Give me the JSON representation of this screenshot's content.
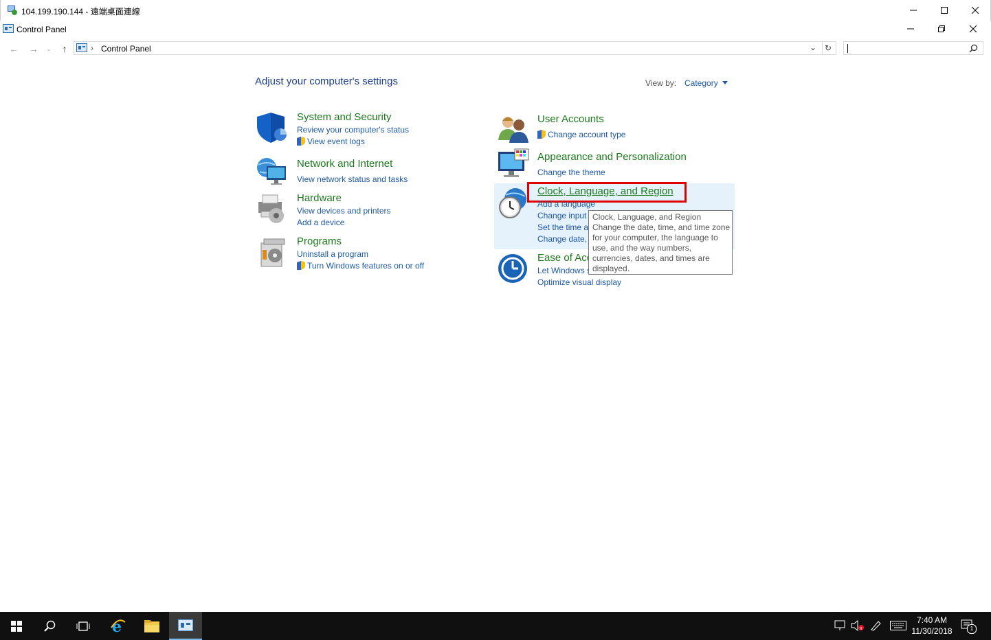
{
  "rdp_window": {
    "title": "104.199.190.144 - 遠端桌面連線"
  },
  "cp_window": {
    "title": "Control Panel"
  },
  "address": {
    "path": "Control Panel",
    "search_placeholder": ""
  },
  "header": {
    "title": "Adjust your computer's settings",
    "view_by_label": "View by:",
    "view_by_value": "Category"
  },
  "left_categories": [
    {
      "title": "System and Security",
      "links": [
        "Review your computer's status",
        "View event logs"
      ]
    },
    {
      "title": "Network and Internet",
      "links": [
        "View network status and tasks"
      ]
    },
    {
      "title": "Hardware",
      "links": [
        "View devices and printers",
        "Add a device"
      ]
    },
    {
      "title": "Programs",
      "links": [
        "Uninstall a program",
        "Turn Windows features on or off"
      ]
    }
  ],
  "right_categories": [
    {
      "title": "User Accounts",
      "links": [
        "Change account type"
      ]
    },
    {
      "title": "Appearance and Personalization",
      "links": [
        "Change the theme"
      ]
    },
    {
      "title": "Clock, Language, and Region",
      "links": [
        "Add a language",
        "Change input",
        "Set the time a",
        "Change date, "
      ]
    },
    {
      "title": "Ease of Acc",
      "links": [
        "Let Windows s",
        "Optimize visual display"
      ]
    }
  ],
  "tooltip": {
    "line1": "Clock, Language, and Region",
    "line2": "Change the date, time, and time zone",
    "line3": "for your computer, the language to",
    "line4": "use, and the way numbers,",
    "line5": "currencies, dates, and times are",
    "line6": "displayed."
  },
  "taskbar": {
    "time": "7:40 AM",
    "date": "11/30/2018",
    "notification_count": "1"
  },
  "colors": {
    "highlight_box": "#e00000",
    "category_green": "#1c7a1c",
    "link_blue": "#1e5aa8",
    "hover_bg": "#e5f1fb"
  }
}
